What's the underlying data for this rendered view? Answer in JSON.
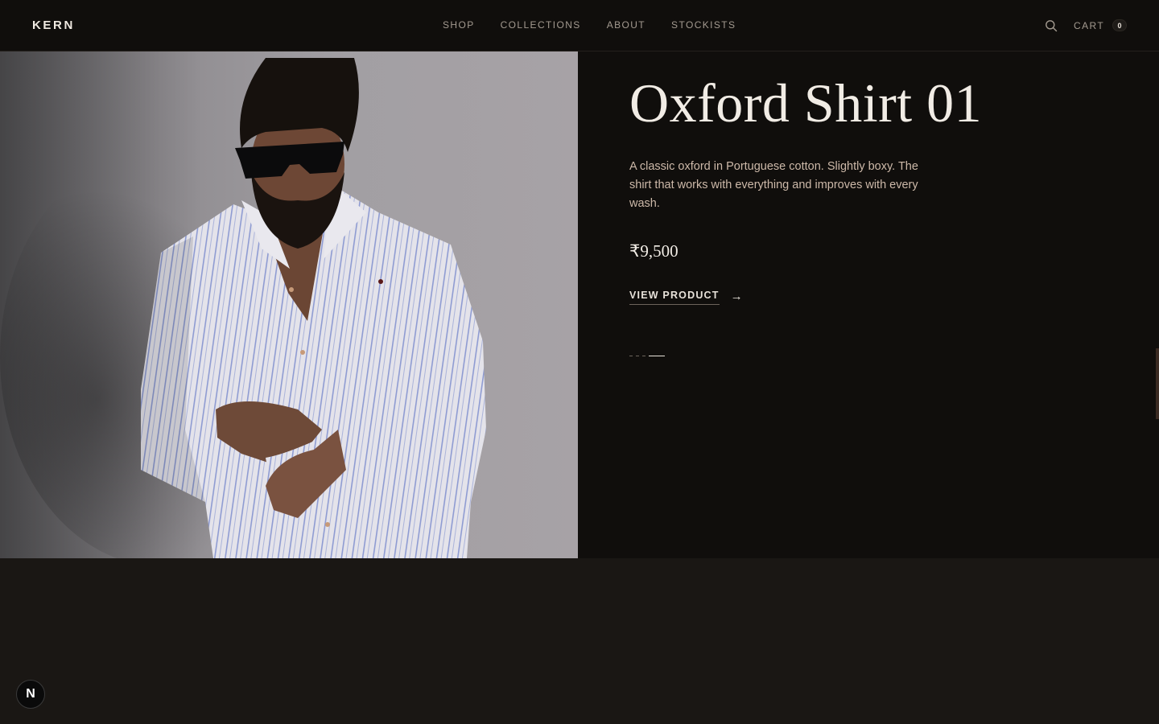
{
  "header": {
    "logo": "KERN",
    "nav": [
      "SHOP",
      "COLLECTIONS",
      "ABOUT",
      "STOCKISTS"
    ],
    "cart_label": "CART",
    "cart_count": "0"
  },
  "product": {
    "title": "Oxford Shirt 01",
    "description": "A classic oxford in Portuguese cotton. Slightly boxy. The shirt that works with everything and improves with every wash.",
    "price": "₹9,500",
    "cta_label": "VIEW PRODUCT",
    "cta_arrow": "→",
    "slides_total": 4,
    "active_slide": 4
  },
  "dev_badge": "N",
  "colors": {
    "background": "#100e0c",
    "text": "#f1ece5",
    "description": "#cdb9a9",
    "muted_nav": "#a39a90"
  },
  "icons": [
    "search-icon",
    "arrow-right-icon"
  ]
}
